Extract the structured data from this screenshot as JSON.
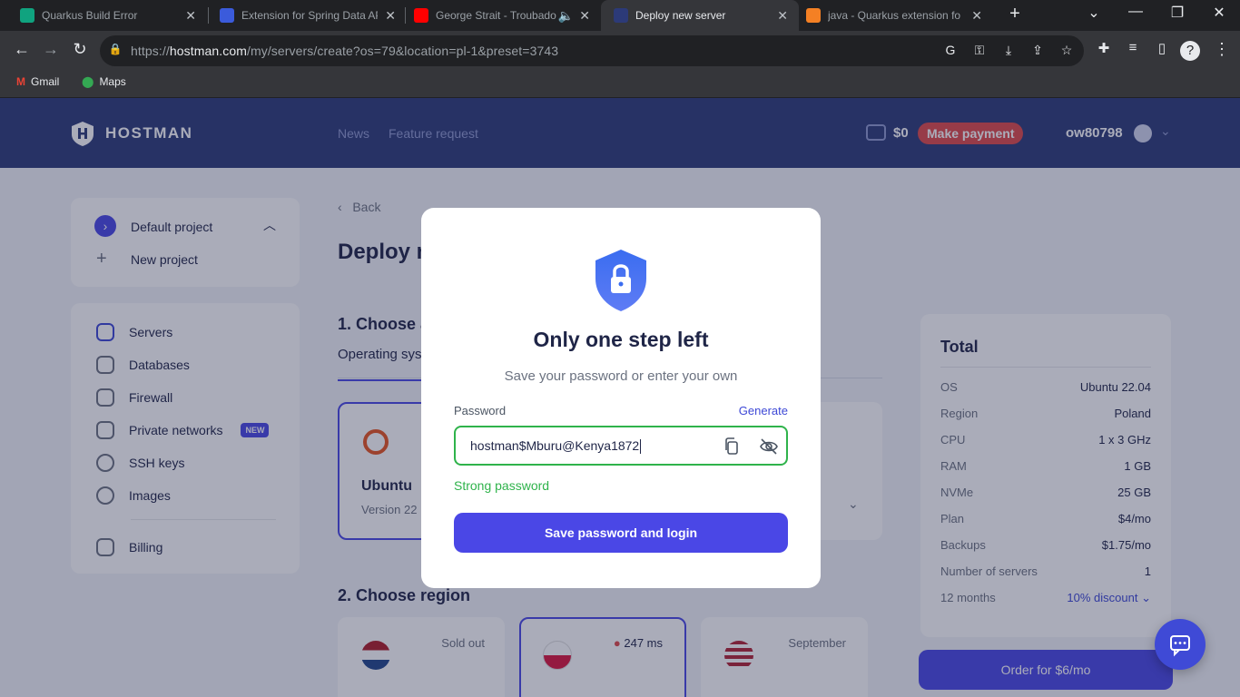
{
  "browser": {
    "tabs": [
      {
        "title": "Quarkus Build Error",
        "fav": "#10a37f"
      },
      {
        "title": "Extension for Spring Data AP",
        "fav": "#3b5bdb"
      },
      {
        "title": "George Strait - Troubado",
        "fav": "#ff0000"
      },
      {
        "title": "Deploy new server",
        "fav": "#2c3a78"
      },
      {
        "title": "java - Quarkus extension fo",
        "fav": "#f48024"
      }
    ],
    "url_prefix": "https://",
    "url_host": "hostman.com",
    "url_path": "/my/servers/create?os=79&location=pl-1&preset=3743",
    "bookmarks": [
      "Gmail",
      "Maps"
    ]
  },
  "header": {
    "logo": "HOSTMAN",
    "nav": [
      "News",
      "Feature request"
    ],
    "balance": "$0",
    "make_payment": "Make payment",
    "username": "ow80798"
  },
  "sidebar": {
    "project": "Default project",
    "new_project": "New project",
    "items": [
      {
        "label": "Servers",
        "icon": "cloud-icon"
      },
      {
        "label": "Databases",
        "icon": "database-icon"
      },
      {
        "label": "Firewall",
        "icon": "firewall-icon"
      },
      {
        "label": "Private networks",
        "icon": "network-icon",
        "badge": "NEW"
      },
      {
        "label": "SSH keys",
        "icon": "key-icon"
      },
      {
        "label": "Images",
        "icon": "disc-icon"
      },
      {
        "label": "Billing",
        "icon": "card-icon"
      }
    ]
  },
  "main": {
    "back": "Back",
    "title": "Deploy n",
    "section1": "1. Choose a",
    "os_tab": "Operating sys",
    "os_name": "Ubuntu",
    "os_version": "Version 22",
    "section2": "2. Choose region",
    "regions": [
      {
        "tag": "Sold out"
      },
      {
        "tag": "247 ms"
      },
      {
        "tag": "September"
      }
    ]
  },
  "total": {
    "title": "Total",
    "rows": [
      {
        "k": "OS",
        "v": "Ubuntu 22.04"
      },
      {
        "k": "Region",
        "v": "Poland"
      },
      {
        "k": "CPU",
        "v": "1 x 3 GHz"
      },
      {
        "k": "RAM",
        "v": "1 GB"
      },
      {
        "k": "NVMe",
        "v": "25 GB"
      },
      {
        "k": "Plan",
        "v": "$4/mo"
      },
      {
        "k": "Backups",
        "v": "$1.75/mo"
      },
      {
        "k": "Number of servers",
        "v": "1"
      },
      {
        "k": "12 months",
        "v": "10% discount"
      }
    ],
    "order": "Order for $6/mo"
  },
  "modal": {
    "title": "Only one step left",
    "subtitle": "Save your password or enter your own",
    "password_label": "Password",
    "generate": "Generate",
    "password_value": "hostman$Mburu@Kenya1872",
    "strength": "Strong password",
    "save_button": "Save password and login"
  }
}
